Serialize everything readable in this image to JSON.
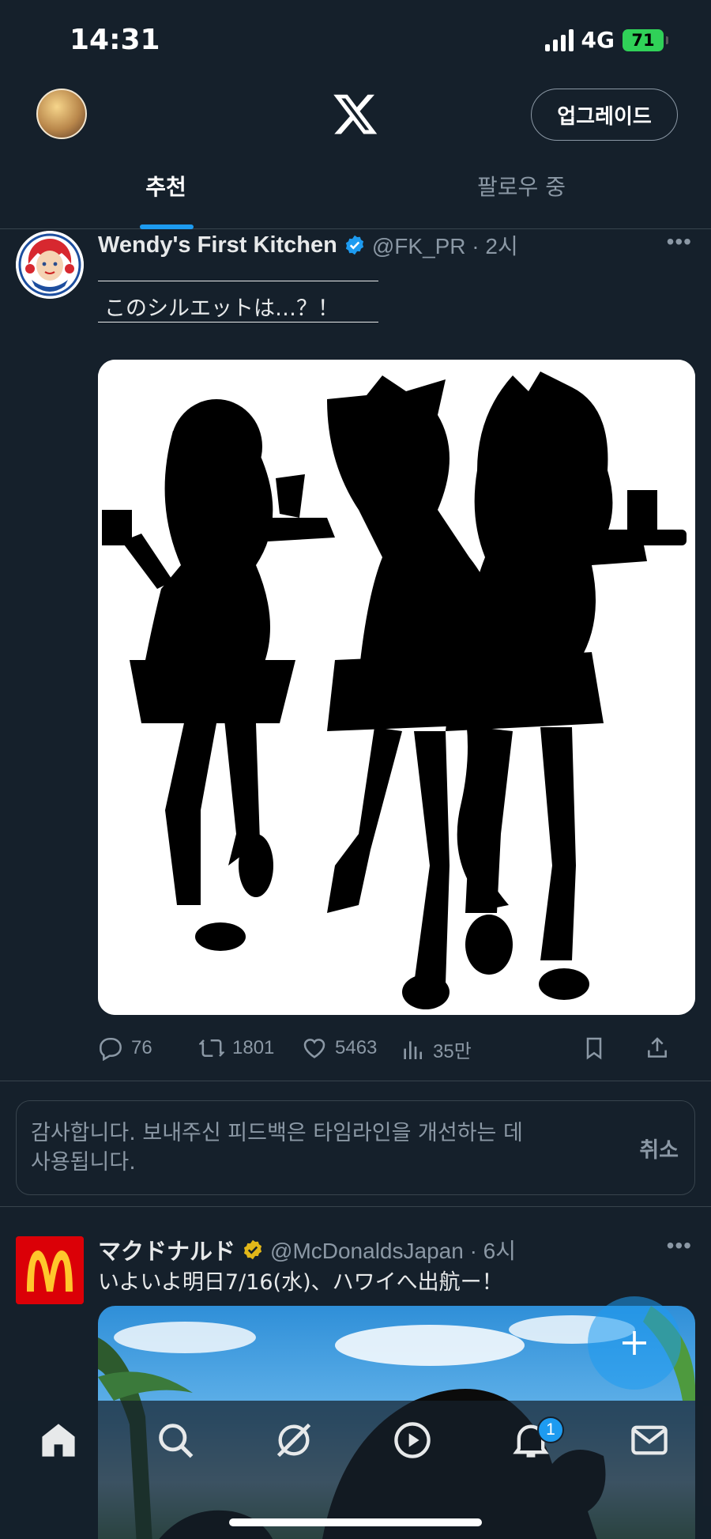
{
  "status_bar": {
    "time": "14:31",
    "network": "4G",
    "battery": "71"
  },
  "header": {
    "upgrade_label": "업그레이드"
  },
  "tabs": [
    {
      "label": "추천",
      "active": true
    },
    {
      "label": "팔로우 중",
      "active": false
    }
  ],
  "tweets": [
    {
      "display_name": "Wendy's First Kitchen",
      "handle_time": "@FK_PR · 2시",
      "verified": "blue",
      "text": "このシルエットは…？！",
      "media": "three-girls-silhouette",
      "replies": "76",
      "reposts": "1801",
      "likes": "5463",
      "views": "35만"
    },
    {
      "display_name": "マクドナルド",
      "handle_time": "@McDonaldsJapan · 6시",
      "verified": "gold",
      "text": "いよいよ明日7/16(水)、ハワイへ出航ー！",
      "media": "beach-silhouette"
    }
  ],
  "feedback": {
    "text": "감사합니다. 보내주신 피드백은 타임라인을 개선하는 데 사용됩니다.",
    "cancel_label": "취소"
  },
  "bottom_nav": {
    "items": [
      "home-icon",
      "search-icon",
      "grok-icon",
      "video-icon",
      "notifications-icon",
      "messages-icon"
    ],
    "notification_count": "1"
  },
  "colors": {
    "background": "#15202b",
    "accent": "#1d9bf0",
    "verified_gold": "#e2b719"
  }
}
